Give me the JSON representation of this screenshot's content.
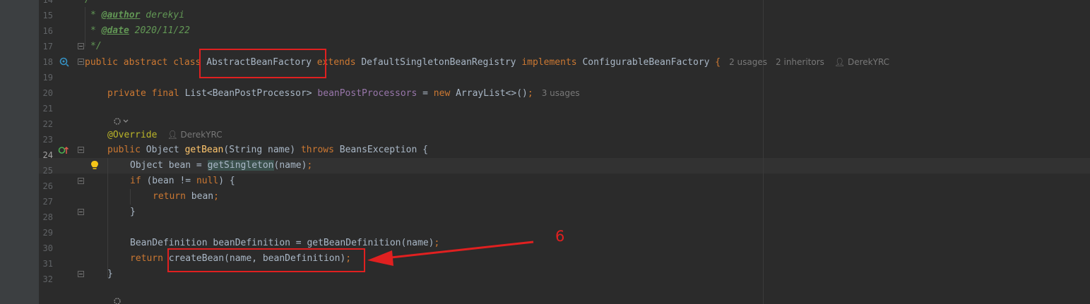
{
  "line_numbers": [
    "14",
    "15",
    "16",
    "17",
    "18",
    "19",
    "20",
    "21",
    "22",
    "23",
    "24",
    "25",
    "26",
    "27",
    "28",
    "29",
    "30",
    "31",
    "32"
  ],
  "active_line": "24",
  "comment": {
    "open": "/**",
    "author_tag": "@author",
    "author": " derekyi",
    "date_tag": "@date",
    "date": " 2020/11/22",
    "close": "*/",
    "star": "* "
  },
  "class_decl": {
    "modifiers": "public abstract class ",
    "name": "AbstractBeanFactory",
    "extends_kw": " extends ",
    "parent": "DefaultSingletonBeanRegistry",
    "implements_kw": " implements ",
    "iface": "ConfigurableBeanFactory",
    "brace": " {",
    "usages": "2 usages",
    "inheritors": "2 inheritors",
    "author": "DerekYRC"
  },
  "field_decl": {
    "modifiers": "private final ",
    "type": "List<BeanPostProcessor> ",
    "name": "beanPostProcessors",
    "assign": " = ",
    "new_kw": "new ",
    "init": "ArrayList<>()",
    "semi": ";",
    "usages": "3 usages"
  },
  "method": {
    "annotation": "@Override",
    "author": "DerekYRC",
    "sig_public": "public ",
    "sig_type": "Object ",
    "sig_name": "getBean",
    "sig_params": "(String name) ",
    "sig_throws": "throws ",
    "sig_exc": "BeansException {",
    "l24_a": "Object bean = ",
    "l24_call": "getSingleton",
    "l24_b": "(name)",
    "l24_semi": ";",
    "l25_if": "if ",
    "l25_a": "(bean != ",
    "l25_null": "null",
    "l25_b": ") {",
    "l26_return": "return ",
    "l26_a": "bean",
    "l26_semi": ";",
    "l27": "}",
    "l29": "BeanDefinition beanDefinition = getBeanDefinition(name)",
    "l29_semi": ";",
    "l30_return": "return ",
    "l30_a": "createBean(name, beanDefinition)",
    "l30_semi": ";",
    "l31": "}"
  },
  "annotation_label": "6",
  "colors": {
    "highlight_box": "#e02020",
    "background": "#2b2b2b"
  },
  "icons": [
    "implementation-gutter-icon",
    "override-gutter-icon",
    "intention-bulb-icon",
    "inlay-settings-icon",
    "person-icon"
  ]
}
